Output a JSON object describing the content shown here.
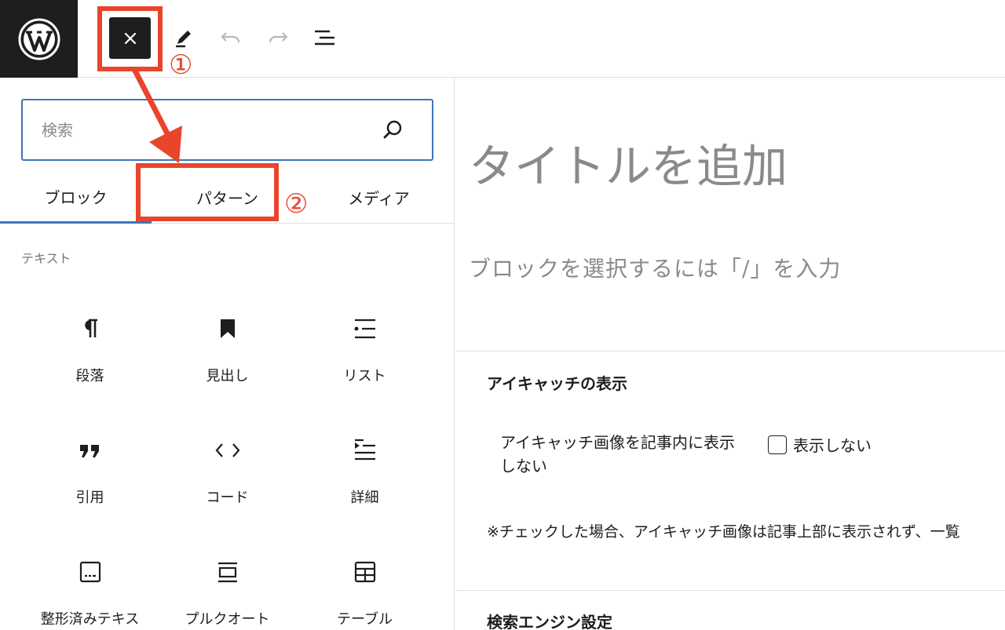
{
  "toolbar": {
    "logo_icon": "wordpress-logo-icon",
    "close_icon": "close-icon",
    "edit_icon": "pencil-icon",
    "undo_icon": "undo-icon",
    "redo_icon": "redo-icon",
    "outline_icon": "list-view-icon"
  },
  "annotations": {
    "step1": "①",
    "step2": "②",
    "color": "#e8452c"
  },
  "inserter": {
    "search": {
      "placeholder": "検索",
      "value": ""
    },
    "tabs": [
      {
        "label": "ブロック",
        "active": true
      },
      {
        "label": "パターン",
        "active": false
      },
      {
        "label": "メディア",
        "active": false
      }
    ],
    "category": "テキスト",
    "blocks": [
      {
        "label": "段落",
        "icon": "paragraph-icon"
      },
      {
        "label": "見出し",
        "icon": "bookmark-icon"
      },
      {
        "label": "リスト",
        "icon": "list-icon"
      },
      {
        "label": "引用",
        "icon": "quote-icon"
      },
      {
        "label": "コード",
        "icon": "code-icon"
      },
      {
        "label": "詳細",
        "icon": "details-icon"
      },
      {
        "label": "整形済みテキス",
        "icon": "preformatted-icon"
      },
      {
        "label": "プルクオート",
        "icon": "pullquote-icon"
      },
      {
        "label": "テーブル",
        "icon": "table-icon"
      }
    ]
  },
  "editor": {
    "title_placeholder": "タイトルを追加",
    "block_placeholder": "ブロックを選択するには「/」を入力",
    "eyecatch": {
      "heading": "アイキャッチの表示",
      "field_label": "アイキャッチ画像を記事内に表示しない",
      "checkbox_label": "表示しない",
      "checked": false,
      "note": "※チェックした場合、アイキャッチ画像は記事上部に表示されず、一覧"
    },
    "seo_heading": "検索エンジン設定"
  },
  "colors": {
    "accent": "#3e74b8",
    "dark": "#1e1e1e",
    "placeholder": "#8a8a8a"
  }
}
